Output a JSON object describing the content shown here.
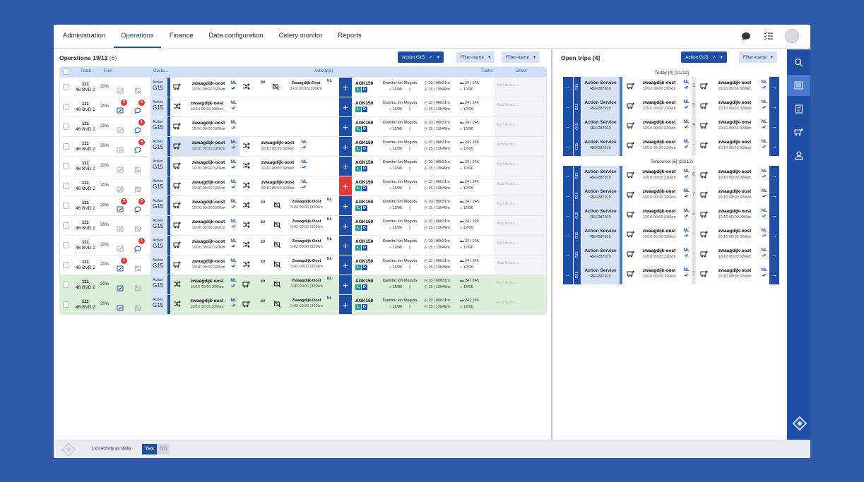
{
  "nav": {
    "tabs": [
      {
        "label": "Administration"
      },
      {
        "label": "Operations"
      },
      {
        "label": "Finance"
      },
      {
        "label": "Data configuration"
      },
      {
        "label": "Celery monitor"
      },
      {
        "label": "Reports"
      }
    ],
    "active": "Operations"
  },
  "left": {
    "title": "Operations 19/12",
    "count": "(6)",
    "action_btn": "Action G15",
    "filter1": "Filter-name",
    "filter2": "Filter-name",
    "headers": {
      "truck": "Truck",
      "fuel": "Fuel",
      "customer": "Custo...",
      "activity": "Activity(s)",
      "trailer": "Trailer",
      "driver": "Driver",
      "extra": "C t"
    }
  },
  "row_defaults": {
    "truck_no": "111",
    "plate": "46 BVD 2",
    "fuel": "20%",
    "action_label": "Action",
    "action_group": "G15",
    "act_title": "zwaagdijk-oost",
    "act_country": "NL",
    "act_sub": "10/10 09:00 320km",
    "act3_title": "Zwaagdijk-Oost",
    "act3_sub": "3-02 09:00 |320km",
    "trailer": "AGK150",
    "driver_name": "Dumitru Ion Moguta",
    "driver_date": "12/06",
    "stat1": "10 | 08h31m",
    "stat2": "15 | 12h49m",
    "stat3": "24 | 24h",
    "stat4": "12/06",
    "notes": "Add Notes ...",
    "tag_l": "L",
    "tag_d": "D",
    "plus": "+",
    "trunc": "zv"
  },
  "rows": [
    {
      "style": "a",
      "badge_task": "",
      "badge_msg": "",
      "red": false,
      "green": false
    },
    {
      "style": "b",
      "badge_task": "2",
      "badge_msg": "1",
      "red": false,
      "green": false
    },
    {
      "style": "c",
      "badge_task": "",
      "badge_msg": "1",
      "red": false,
      "green": false
    },
    {
      "style": "d",
      "badge_task": "",
      "badge_msg": "4",
      "red": false,
      "green": false
    },
    {
      "style": "e",
      "badge_task": "",
      "badge_msg": "",
      "red": false,
      "green": false
    },
    {
      "style": "e",
      "badge_task": "",
      "badge_msg": "",
      "red": true,
      "green": false
    },
    {
      "style": "f",
      "badge_task": "3",
      "badge_msg": "2",
      "red": false,
      "green": false
    },
    {
      "style": "f",
      "badge_task": "",
      "badge_msg": "",
      "red": false,
      "green": false
    },
    {
      "style": "f",
      "badge_task": "",
      "badge_msg": "1",
      "red": false,
      "green": false
    },
    {
      "style": "f",
      "badge_task": "1",
      "badge_msg": "",
      "red": false,
      "green": false
    },
    {
      "style": "g",
      "badge_task": "",
      "badge_msg": "",
      "red": false,
      "green": true
    },
    {
      "style": "g",
      "badge_task": "",
      "badge_msg": "",
      "red": false,
      "green": true
    }
  ],
  "right": {
    "title": "Open trips [4]",
    "action_btn": "Action G15",
    "filter": "Filter-name",
    "today_label": "Today [4] (21/12)",
    "tomorrow_label": "Tomorrow [6] (22/12)",
    "trip_service": "Action Service",
    "trip_ref": "REF287919",
    "trip_group": "G15",
    "trip_title": "zwaagdijk-oost",
    "trip_country": "NL",
    "trip_sub": "10/10 09:00 320km",
    "today_nums": [
      "3",
      "5",
      "9",
      "-"
    ],
    "tomorrow_nums": [
      "6",
      "7",
      "2",
      "-",
      "-",
      "1"
    ],
    "arrow_left": "←",
    "arrow_right": "→"
  },
  "footer": {
    "label": "Last activity as sticky",
    "yes": "Yes",
    "no": "No"
  },
  "colors": {
    "primary": "#1c4fa5",
    "light": "#d8e4f6",
    "danger": "#e03b3b",
    "green_row": "#dcefd9"
  }
}
